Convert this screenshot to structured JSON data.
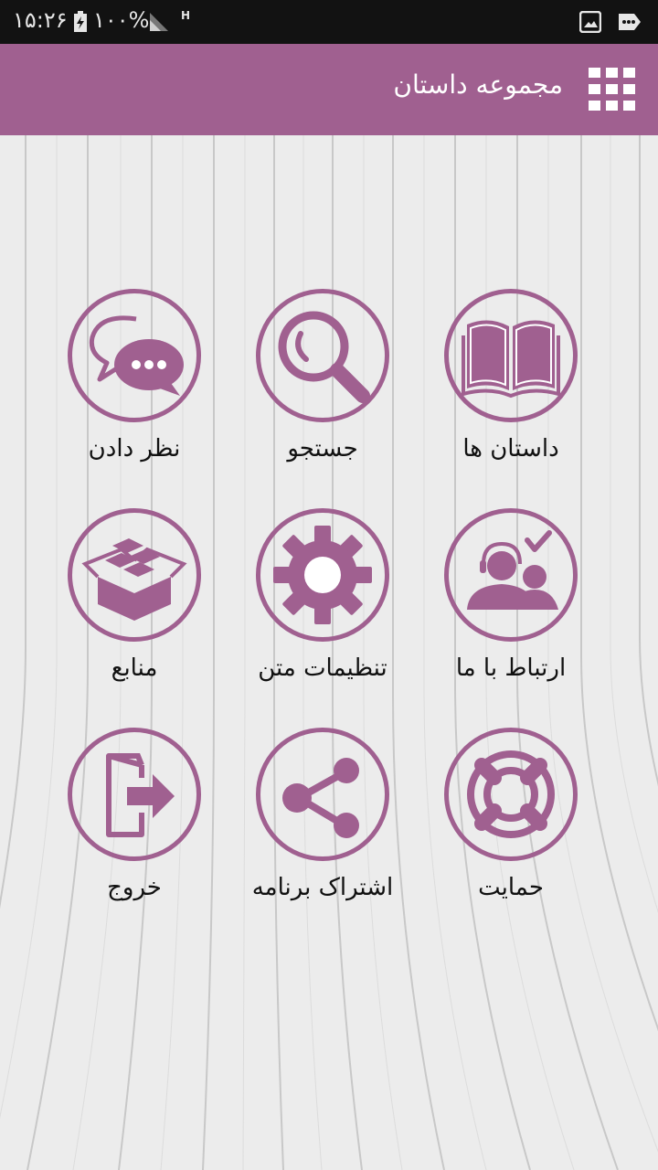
{
  "status_bar": {
    "time": "۱۵:۲۶",
    "battery": "۱۰۰%",
    "network": "H",
    "icons": [
      "battery-charging-icon",
      "signal-icon",
      "image-icon",
      "more-icon"
    ]
  },
  "app_bar": {
    "title": "مجموعه داستان",
    "menu_icon": "grid-icon"
  },
  "menu": {
    "items": [
      {
        "label": "داستان ها",
        "icon": "book-icon"
      },
      {
        "label": "جستجو",
        "icon": "search-icon"
      },
      {
        "label": "نظر دادن",
        "icon": "chat-bubbles-icon"
      },
      {
        "label": "ارتباط با ما",
        "icon": "support-agent-icon"
      },
      {
        "label": "تنظیمات متن",
        "icon": "gear-icon"
      },
      {
        "label": "منابع",
        "icon": "box-icon"
      },
      {
        "label": "حمایت",
        "icon": "lifebuoy-icon"
      },
      {
        "label": "اشتراک برنامه",
        "icon": "share-icon"
      },
      {
        "label": "خروج",
        "icon": "exit-icon"
      }
    ]
  },
  "colors": {
    "accent": "#a06090",
    "status_bar": "#121212",
    "background": "#e9e9e9"
  }
}
